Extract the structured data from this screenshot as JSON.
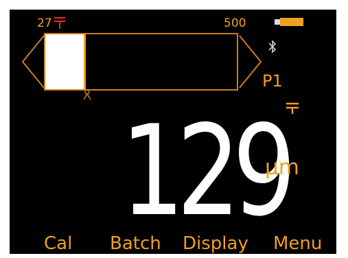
{
  "scale": {
    "min_label": "27",
    "max_label": "500",
    "fill_fraction": 0.2
  },
  "status": {
    "program": "P1",
    "battery_icon": "battery-icon",
    "bluetooth_icon": "bluetooth-icon"
  },
  "reading": {
    "value": "129",
    "unit": "µm"
  },
  "softkeys": {
    "cal": "Cal",
    "batch": "Batch",
    "display": "Display",
    "menu": "Menu"
  },
  "colors": {
    "accent": "#f0a020",
    "limit_marker": "#e8302a",
    "background": "#000000",
    "reading": "#ffffff"
  }
}
